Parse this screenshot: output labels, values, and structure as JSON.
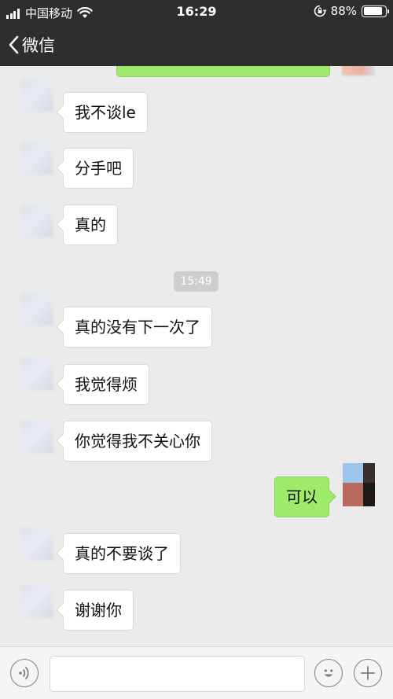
{
  "status_bar": {
    "carrier": "中国移动",
    "time": "16:29",
    "battery_percent": "88%",
    "battery_level": 0.88
  },
  "nav": {
    "back_label": "微信"
  },
  "chat": {
    "messages": [
      {
        "side": "left",
        "text": "我不谈le"
      },
      {
        "side": "left",
        "text": "分手吧"
      },
      {
        "side": "left",
        "text": "真的"
      },
      {
        "side": "left",
        "text": "真的没有下一次了"
      },
      {
        "side": "left",
        "text": "我觉得烦"
      },
      {
        "side": "left",
        "text": "你觉得我不关心你"
      },
      {
        "side": "right",
        "text": "可以"
      },
      {
        "side": "left",
        "text": "真的不要谈了"
      },
      {
        "side": "left",
        "text": "谢谢你"
      }
    ],
    "timestamp": "15:49"
  },
  "input_bar": {
    "icons": [
      "voice-icon",
      "emoji-icon",
      "plus-icon"
    ],
    "message_value": ""
  },
  "colors": {
    "nav_bg": "#2e2e2e",
    "chat_bg": "#ebebeb",
    "sent_bubble": "#9eea6a",
    "received_bubble": "#ffffff"
  }
}
